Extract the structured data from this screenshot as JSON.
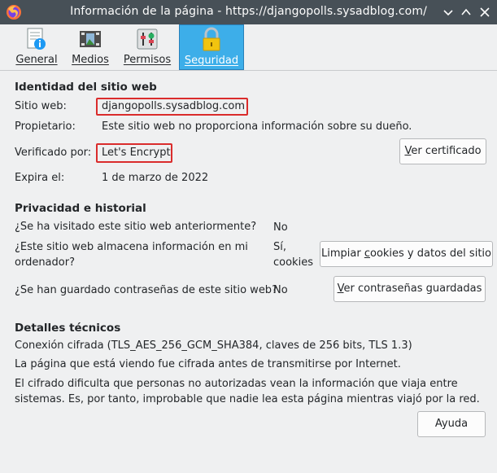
{
  "window": {
    "title": "Información de la página - https://djangopolls.sysadblog.com/"
  },
  "tabs": [
    {
      "label": "General",
      "icon": "info-icon"
    },
    {
      "label": "Medios",
      "icon": "media-icon"
    },
    {
      "label": "Permisos",
      "icon": "permissions-icon"
    },
    {
      "label": "Seguridad",
      "icon": "lock-icon",
      "active": true
    }
  ],
  "identity": {
    "heading": "Identidad del sitio web",
    "website_label": "Sitio web:",
    "website_value": "djangopolls.sysadblog.com",
    "owner_label": "Propietario:",
    "owner_value": "Este sitio web no proporciona información sobre su dueño.",
    "verified_label": "Verificado por:",
    "verified_value": "Let's Encrypt",
    "view_cert_button": {
      "pre": "",
      "u": "V",
      "post": "er certificado"
    },
    "expires_label": "Expira el:",
    "expires_value": "1 de marzo de 2022"
  },
  "privacy": {
    "heading": "Privacidad e historial",
    "q1": "¿Se ha visitado este sitio web anteriormente?",
    "a1": "No",
    "q2_line1": "¿Este sitio web almacena información en mi",
    "q2_line2": "ordenador?",
    "a2_line1": "Sí,",
    "a2_line2": "cookies",
    "clear_cookies_button": {
      "pre": "Limpiar ",
      "u": "c",
      "post": "ookies y datos del sitio"
    },
    "q3": "¿Se han guardado contraseñas de este sitio web?",
    "a3": "No",
    "view_passwords_button": {
      "pre": "",
      "u": "V",
      "post": "er contraseñas guardadas"
    }
  },
  "technical": {
    "heading": "Detalles técnicos",
    "line1": "Conexión cifrada (TLS_AES_256_GCM_SHA384, claves de 256 bits, TLS 1.3)",
    "line2": "La página que está viendo fue cifrada antes de transmitirse por Internet.",
    "line3": "El cifrado dificulta que personas no autorizadas vean la información que viaja entre",
    "line4": "sistemas. Es, por tanto, improbable que nadie lea esta página mientras viajó por la red."
  },
  "help_button": "Ayuda",
  "colors": {
    "titlebar": "#475057",
    "active_tab": "#3daee9",
    "highlight": "#da2c2c",
    "background": "#eff0f1"
  }
}
